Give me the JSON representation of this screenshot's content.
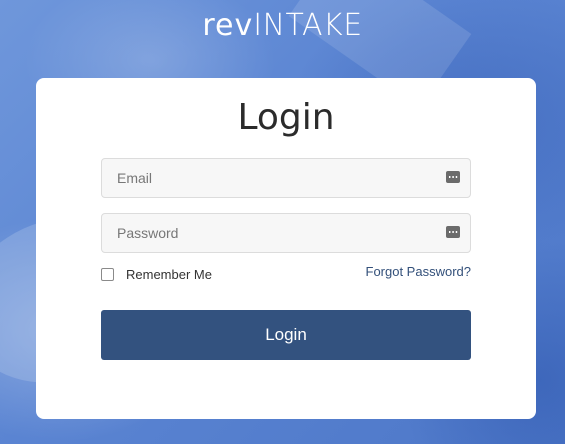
{
  "brand": {
    "logo_prefix": "rev",
    "logo_suffix": "INTAKE"
  },
  "login": {
    "title": "Login",
    "email_placeholder": "Email",
    "password_placeholder": "Password",
    "remember_label": "Remember Me",
    "forgot_label": "Forgot Password?",
    "submit_label": "Login"
  },
  "colors": {
    "background": "#5b86d4",
    "card": "#ffffff",
    "button": "#33527f",
    "link": "#33507a"
  }
}
